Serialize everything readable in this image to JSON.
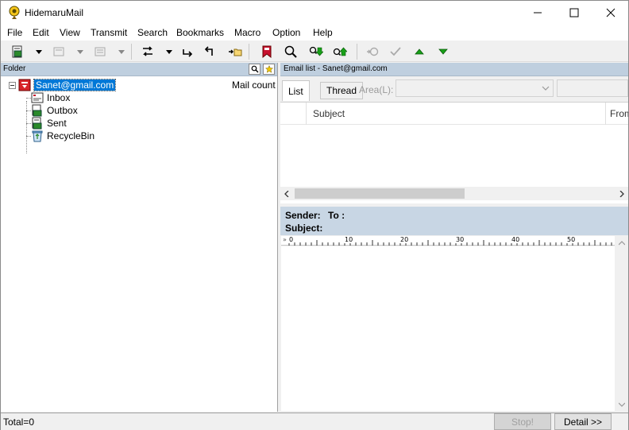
{
  "window": {
    "title": "HidemaruMail",
    "icon": "hidemaru-app-icon"
  },
  "menu": [
    "File",
    "Edit",
    "View",
    "Transmit",
    "Search",
    "Bookmarks",
    "Macro",
    "Option",
    "Help"
  ],
  "folder_pane": {
    "header": "Folder",
    "mail_count_header": "Mail count",
    "account": "Sanet@gmail.com",
    "folders": [
      "Inbox",
      "Outbox",
      "Sent",
      "RecycleBin"
    ]
  },
  "email_pane": {
    "header": "Email list - Sanet@gmail.com",
    "tabs": [
      "List",
      "Thread"
    ],
    "area_label": "Area(L):",
    "columns": [
      "Subject",
      "From"
    ]
  },
  "preview": {
    "sender_label": "Sender:",
    "to_label": "To :",
    "subject_label": "Subject:",
    "ruler_marks": [
      "0",
      "10",
      "20",
      "30",
      "40",
      "50"
    ]
  },
  "status": {
    "text": "Total=0",
    "stop_label": "Stop!",
    "detail_label": "Detail >>"
  },
  "colors": {
    "selection": "#0078d7",
    "pane_header": "#bfcfdf",
    "preview_header": "#c8d6e4",
    "green_arrow": "#10a010"
  }
}
